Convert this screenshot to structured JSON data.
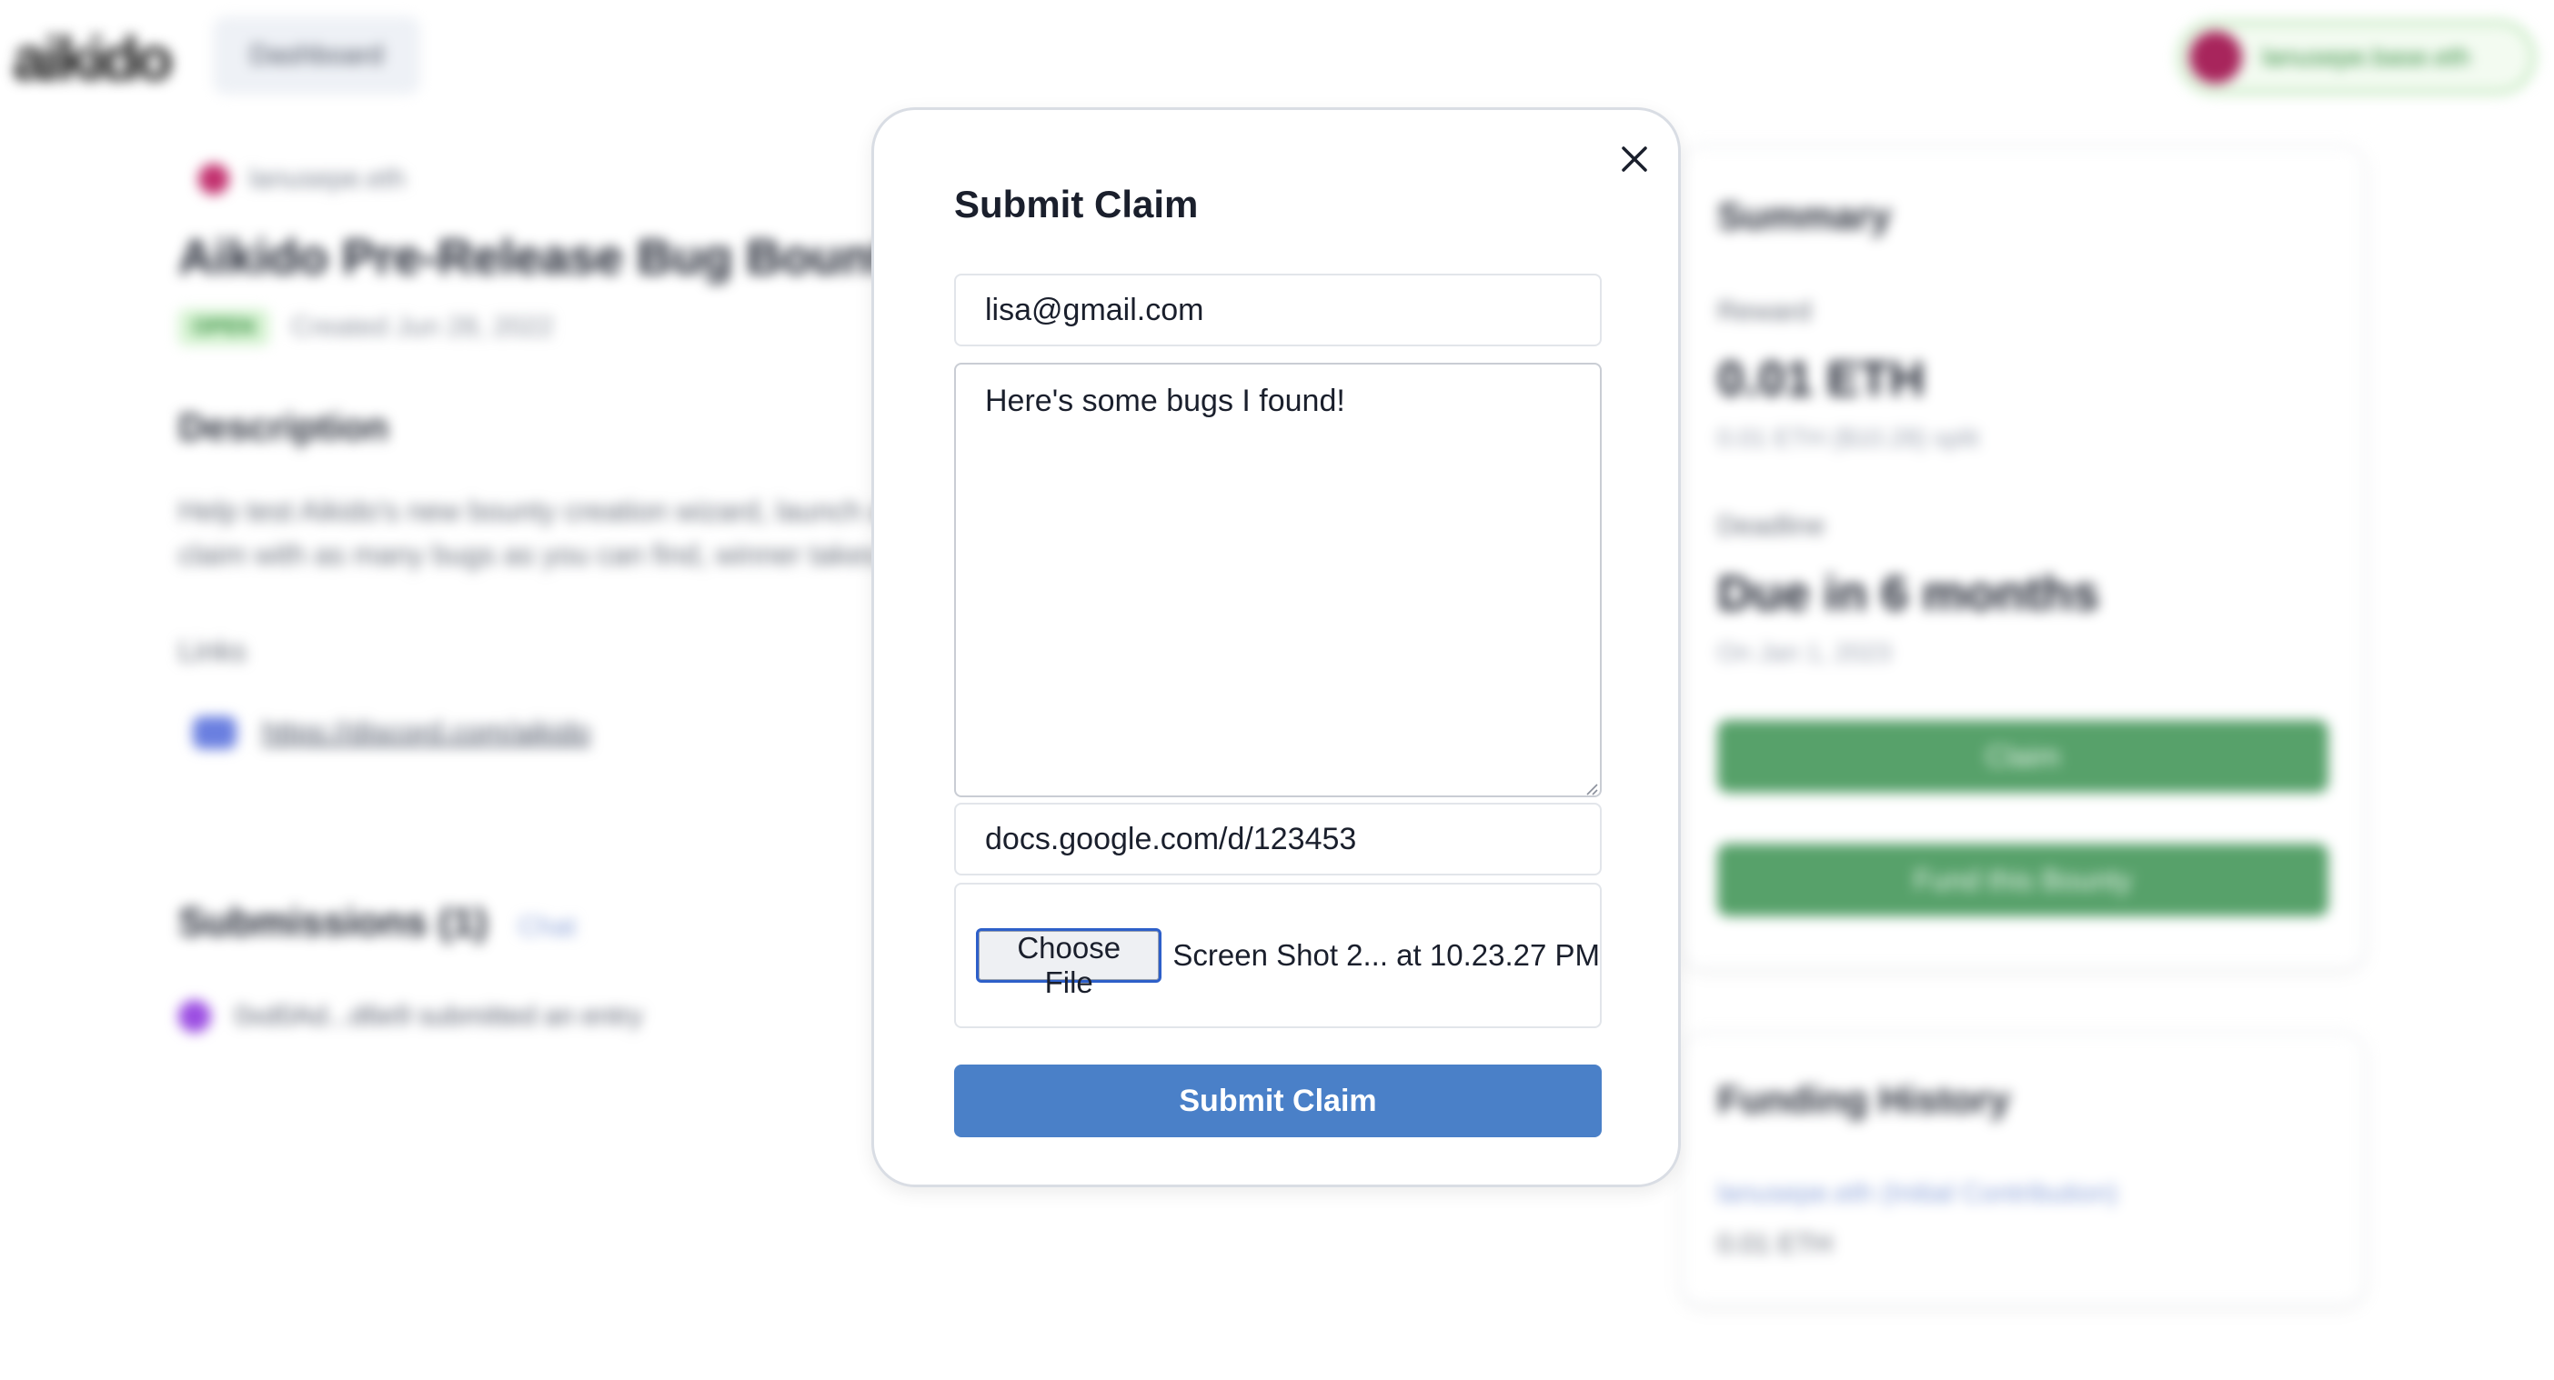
{
  "header": {
    "logo_text": "aikido",
    "dashboard_label": "Dashboard",
    "wallet_label": "lanusepe.base.eth"
  },
  "bounty": {
    "creator": "lanusepe.eth",
    "title": "Aikido Pre-Release Bug Bounty",
    "status": "OPEN",
    "created": "Created Jun 28, 2022",
    "description_heading": "Description",
    "description": "Help test Aikido's new bounty creation wizard, launch a claim with as many bugs as you can find, winner takes",
    "links_heading": "Links",
    "link": "https://discord.com/aikido",
    "submissions_heading": "Submissions (1)",
    "submissions_action": "Chat",
    "submission_text": "0xd0Ad...d6e9 submitted an entry"
  },
  "summary": {
    "title": "Summary",
    "reward_label": "Reward",
    "reward_value": "0.01 ETH",
    "reward_sub": "0.01 ETH ($10.28) split",
    "deadline_label": "Deadline",
    "deadline_value": "Due in 6 months",
    "deadline_sub": "On Jan 1, 2023",
    "claim_button": "Claim",
    "fund_button": "Fund this Bounty"
  },
  "funding": {
    "title": "Funding History",
    "entry": "lanusepe.eth (Initial Contribution)",
    "amount": "0.01 ETH"
  },
  "modal": {
    "title": "Submit Claim",
    "email_value": "lisa@gmail.com",
    "message_value": "Here's some bugs I found!",
    "link_value": "docs.google.com/d/123453",
    "choose_file_label": "Choose File",
    "file_name": "Screen Shot 2... at 10.23.27 PM",
    "submit_label": "Submit Claim"
  },
  "colors": {
    "submit_button": "#4a80c8",
    "green_button": "#57a16a"
  },
  "icons": {
    "close": "close-icon",
    "discord": "discord-icon"
  }
}
